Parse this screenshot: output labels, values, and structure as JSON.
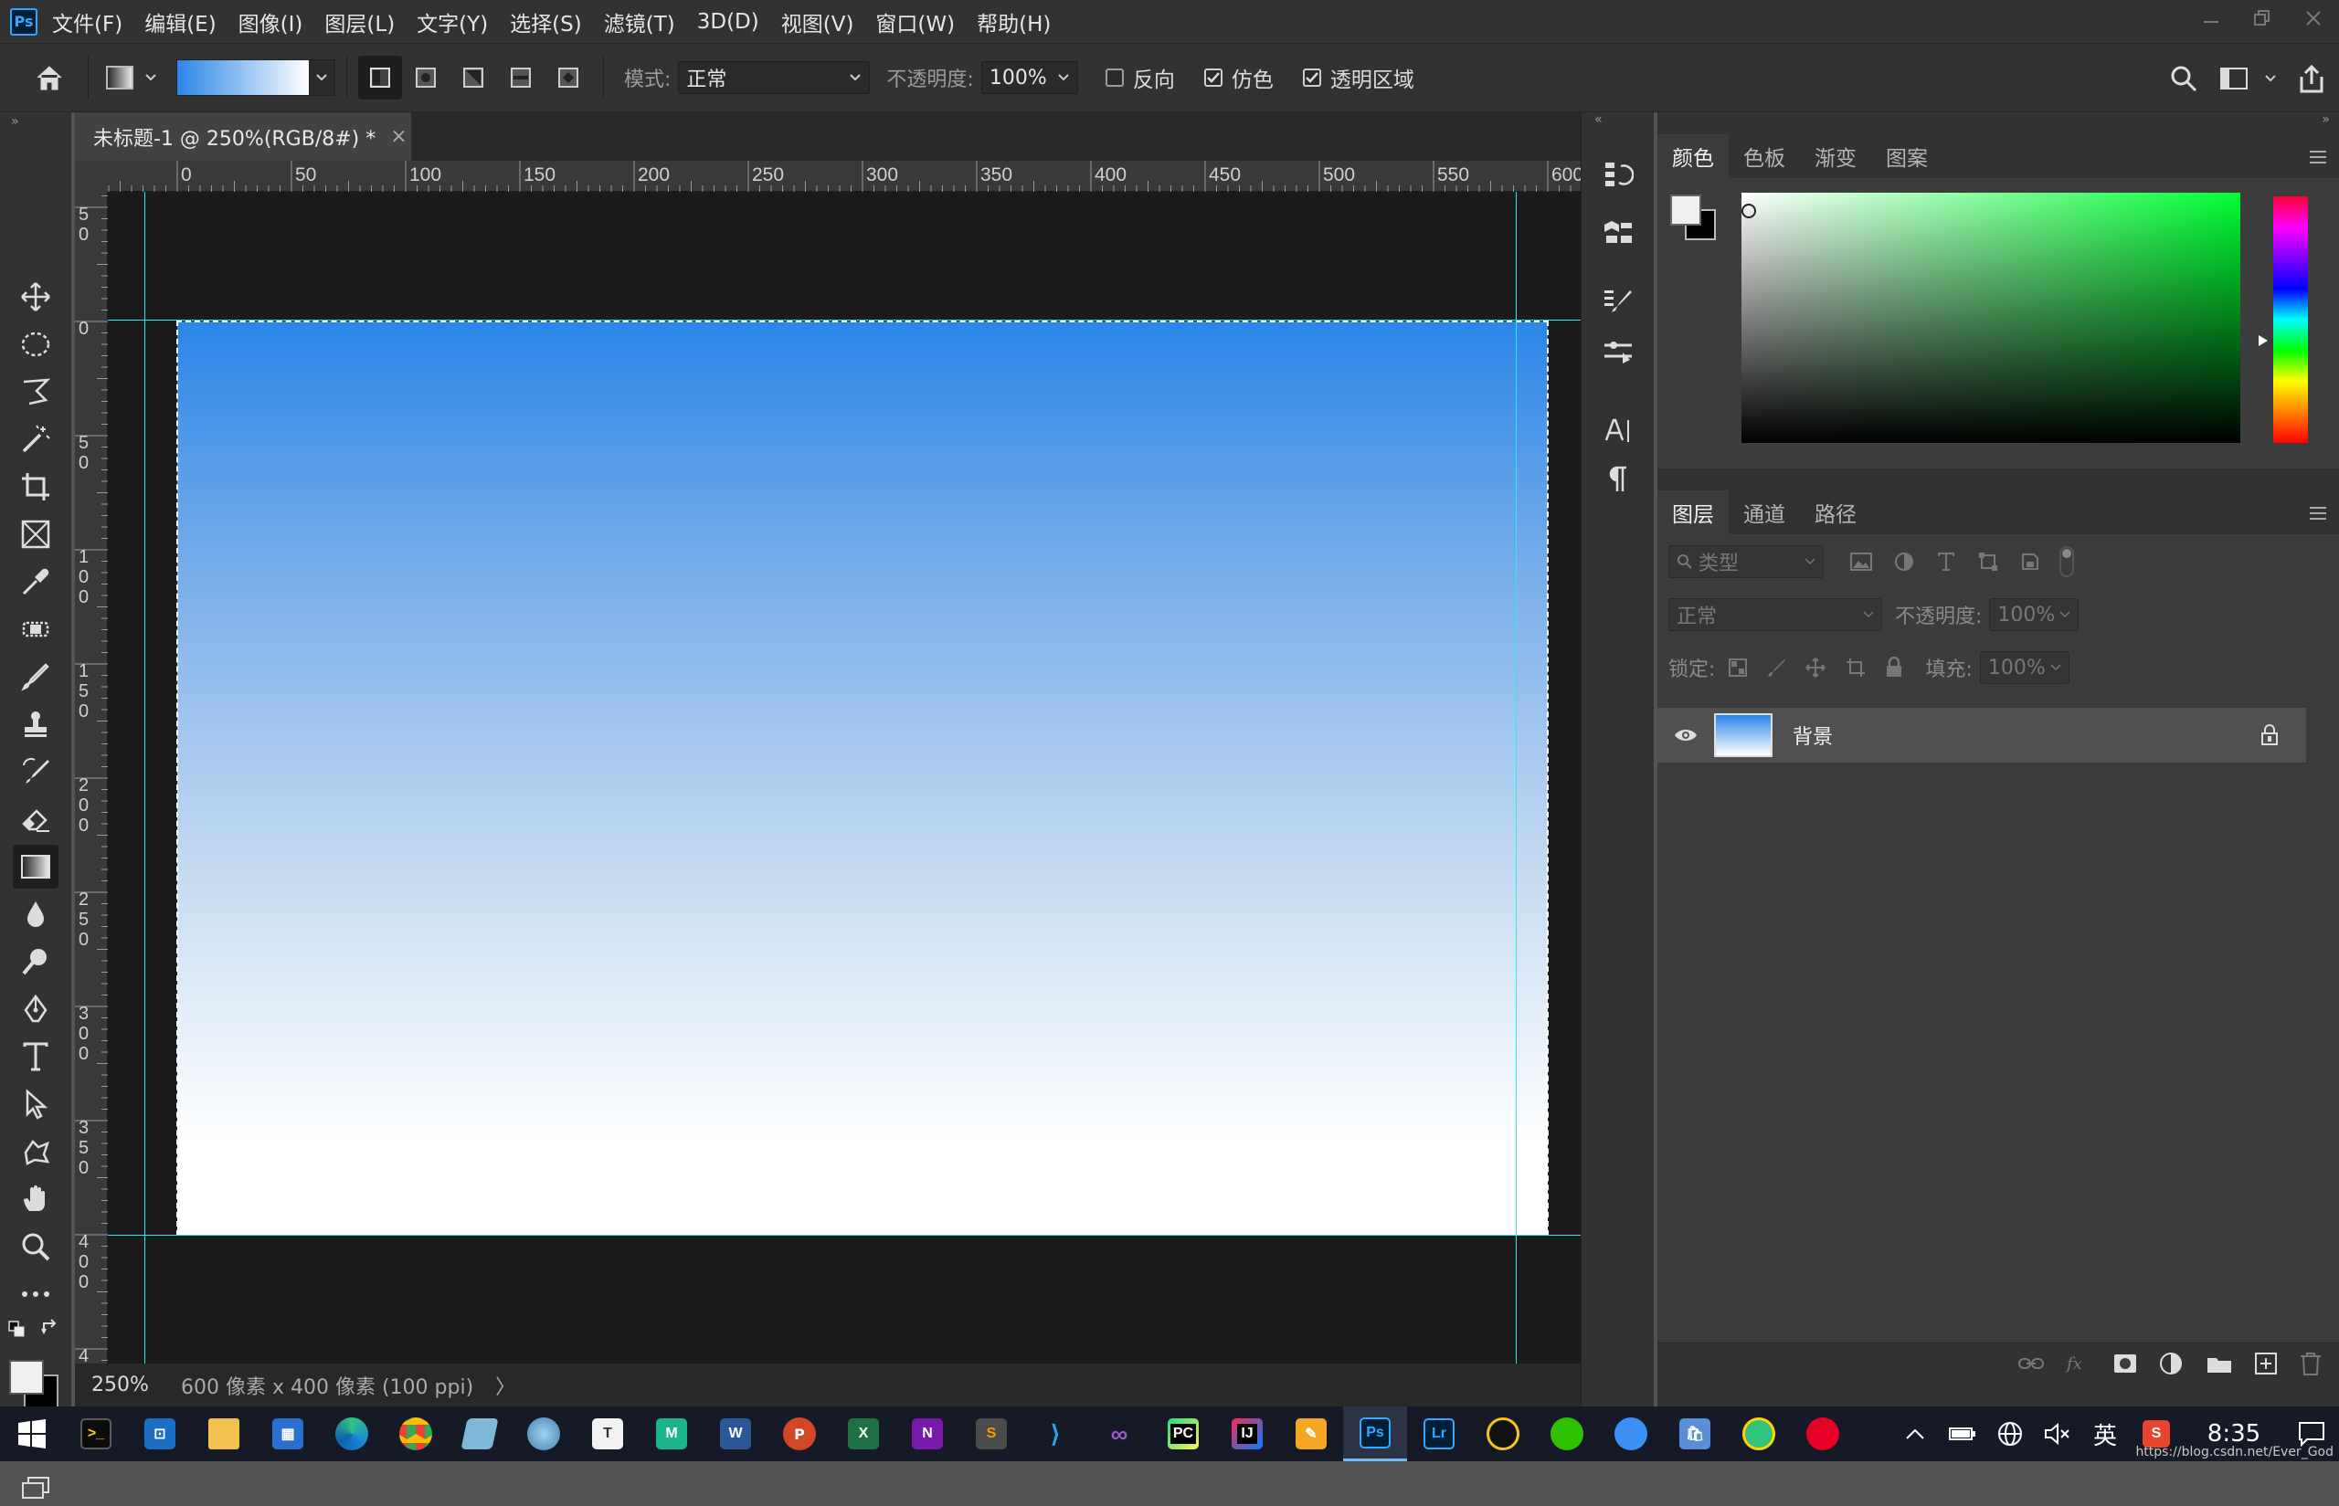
{
  "app": {
    "logo": "Ps",
    "brand_color": "#31a8ff"
  },
  "menu": [
    "文件(F)",
    "编辑(E)",
    "图像(I)",
    "图层(L)",
    "文字(Y)",
    "选择(S)",
    "滤镜(T)",
    "3D(D)",
    "视图(V)",
    "窗口(W)",
    "帮助(H)"
  ],
  "options": {
    "mode_label": "模式:",
    "mode_value": "正常",
    "opacity_label": "不透明度:",
    "opacity_value": "100%",
    "reverse_label": "反向",
    "reverse_checked": false,
    "dither_label": "仿色",
    "dither_checked": true,
    "transparency_label": "透明区域",
    "transparency_checked": true
  },
  "document": {
    "tab_title": "未标题-1 @ 250%(RGB/8#) *",
    "tab_close": "×",
    "zoom": "250%",
    "info": "600 像素 x 400 像素 (100 ppi)",
    "info_arrow": "〉",
    "gradient_from": "#2b86e8",
    "gradient_to": "#ffffff"
  },
  "ruler": {
    "h_labels": [
      "0",
      "50",
      "100",
      "150",
      "200",
      "250",
      "300",
      "350",
      "400",
      "450",
      "500",
      "550",
      "600"
    ],
    "v_labels": [
      "50",
      "0",
      "50",
      "100",
      "150",
      "200",
      "250",
      "300",
      "350",
      "400",
      "4"
    ]
  },
  "color_panel": {
    "tabs": [
      "颜色",
      "色板",
      "渐变",
      "图案"
    ],
    "active_tab": 0,
    "hue_color": "#00ff33"
  },
  "layers_panel": {
    "tabs": [
      "图层",
      "通道",
      "路径"
    ],
    "active_tab": 0,
    "filter_placeholder": "类型",
    "blend_mode": "正常",
    "opacity_label": "不透明度:",
    "opacity_value": "100%",
    "lock_label": "锁定:",
    "fill_label": "填充:",
    "fill_value": "100%",
    "layers": [
      {
        "name": "背景",
        "visible": true,
        "locked": true
      }
    ]
  },
  "taskbar": {
    "apps": [
      "windows-start",
      "terminal",
      "remote-desktop",
      "file-explorer",
      "calculator",
      "edge",
      "chrome",
      "vmware",
      "photos-app",
      "typora",
      "mindmaster",
      "word",
      "powerpoint",
      "excel",
      "onenote",
      "sublime-text",
      "vscode",
      "visual-studio",
      "pycharm",
      "intellij-idea",
      "notes-app",
      "photoshop",
      "lightroom",
      "qq",
      "wechat",
      "feishu",
      "store",
      "qq-music",
      "netease-music"
    ],
    "tray_lang": "英",
    "time": "8:35",
    "watermark": "https://blog.csdn.net/Ever_God"
  }
}
